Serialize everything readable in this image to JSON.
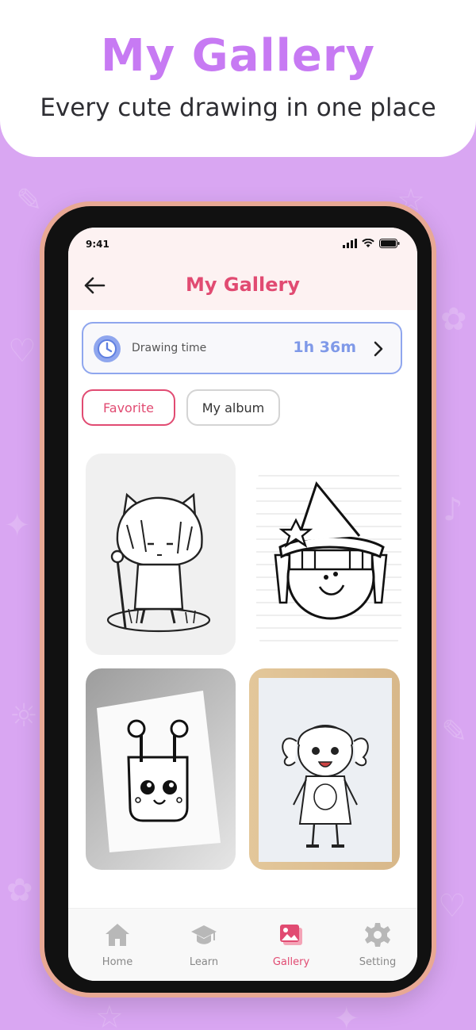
{
  "promo": {
    "title": "My Gallery",
    "subtitle": "Every cute drawing in one place"
  },
  "status_bar": {
    "time": "9:41",
    "icons": [
      "signal-icon",
      "wifi-icon",
      "battery-icon"
    ]
  },
  "header": {
    "title": "My Gallery",
    "back_icon": "arrow-left-icon"
  },
  "drawing_time": {
    "label": "Drawing time",
    "value": "1h 36m",
    "icon": "clock-icon"
  },
  "tabs": [
    {
      "label": "Favorite",
      "active": true
    },
    {
      "label": "My album",
      "active": false
    }
  ],
  "gallery": {
    "items": [
      {
        "subject": "chibi boy with cat hood and staff"
      },
      {
        "subject": "witch girl with star hat"
      },
      {
        "subject": "kawaii earbuds case"
      },
      {
        "subject": "little girl with pigtails"
      }
    ]
  },
  "bottom_nav": {
    "items": [
      {
        "label": "Home",
        "icon": "home-icon"
      },
      {
        "label": "Learn",
        "icon": "graduation-cap-icon"
      },
      {
        "label": "Gallery",
        "icon": "gallery-icon",
        "active": true
      },
      {
        "label": "Setting",
        "icon": "gear-icon"
      }
    ]
  },
  "colors": {
    "background": "#d9a6f2",
    "promo_title": "#c77af3",
    "accent": "#e14b72",
    "timer_accent": "#7f99e8",
    "phone_frame": "#e8a894"
  }
}
